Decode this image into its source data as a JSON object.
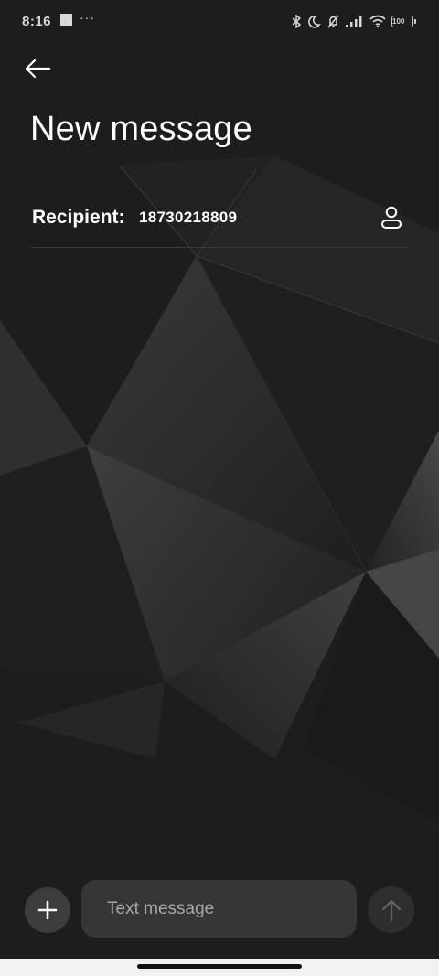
{
  "status_bar": {
    "time": "8:16",
    "dots": "···",
    "battery_level": "100",
    "icons": [
      "bluetooth-icon",
      "moon-icon",
      "muted-bell-icon",
      "signal-icon",
      "wifi-icon",
      "battery-icon"
    ]
  },
  "header": {
    "back_icon": "back-arrow-icon",
    "title": "New message"
  },
  "recipient": {
    "label": "Recipient:",
    "value": "18730218809",
    "contact_icon": "person-icon"
  },
  "composer": {
    "add_icon": "plus-icon",
    "placeholder": "Text message",
    "value": "",
    "send_icon": "arrow-up-icon"
  },
  "colors": {
    "background": "#1d1d1d",
    "input_background": "#363636",
    "text": "#ffffff",
    "placeholder": "#a6a6a6",
    "nav_bar": "#f2f2f2"
  }
}
